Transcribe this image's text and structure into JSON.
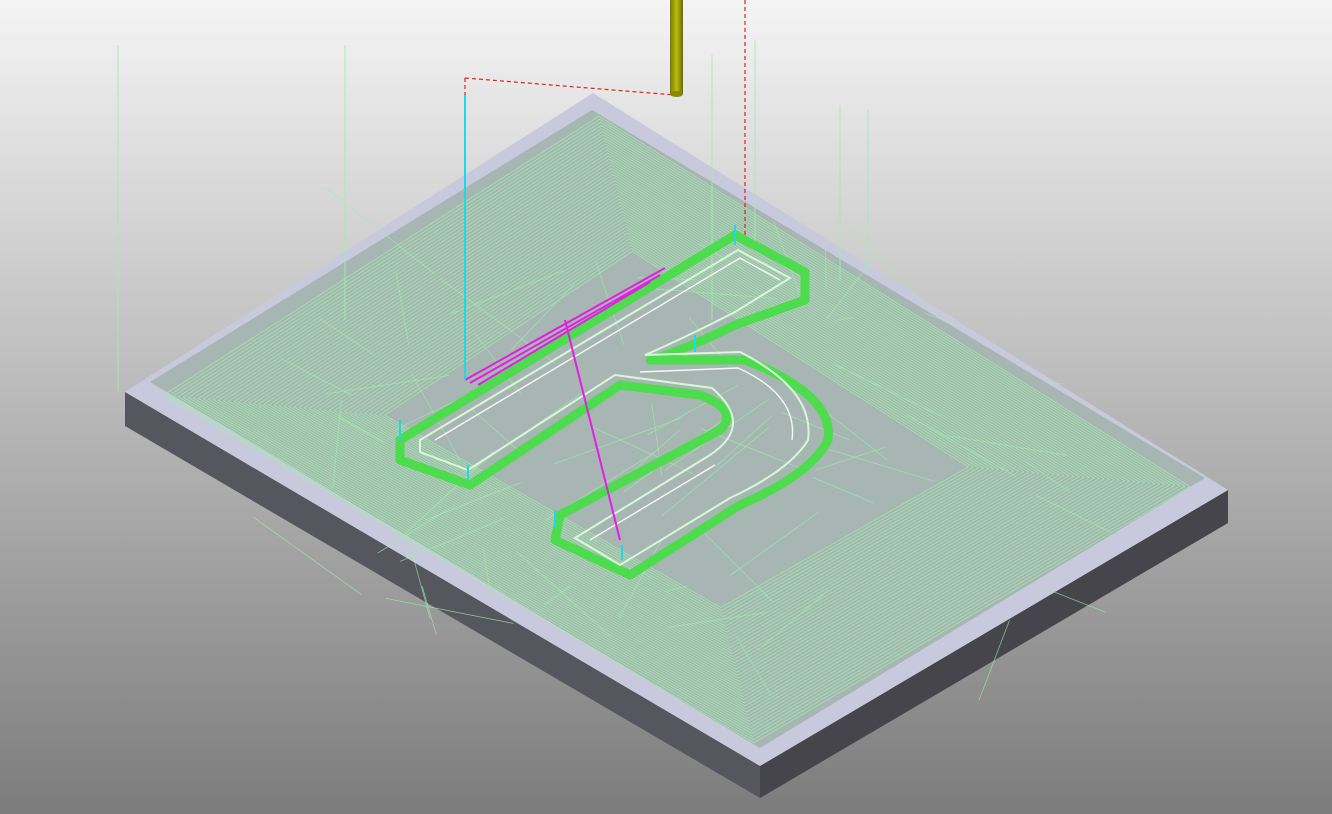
{
  "viewport": {
    "colors": {
      "background_top": "#f4f4f4",
      "background_bottom": "#7c7c7c",
      "stock_top": "#c9c9dd",
      "stock_side": "#56565e",
      "stock_front": "#45454b",
      "toolpath": "#9cf0a8",
      "profile": "#4ddc4d",
      "tool": "#a6a600",
      "rapid_move": "#e02020",
      "lead_move": "#e020e0",
      "plunge_move": "#20d8e8"
    }
  }
}
